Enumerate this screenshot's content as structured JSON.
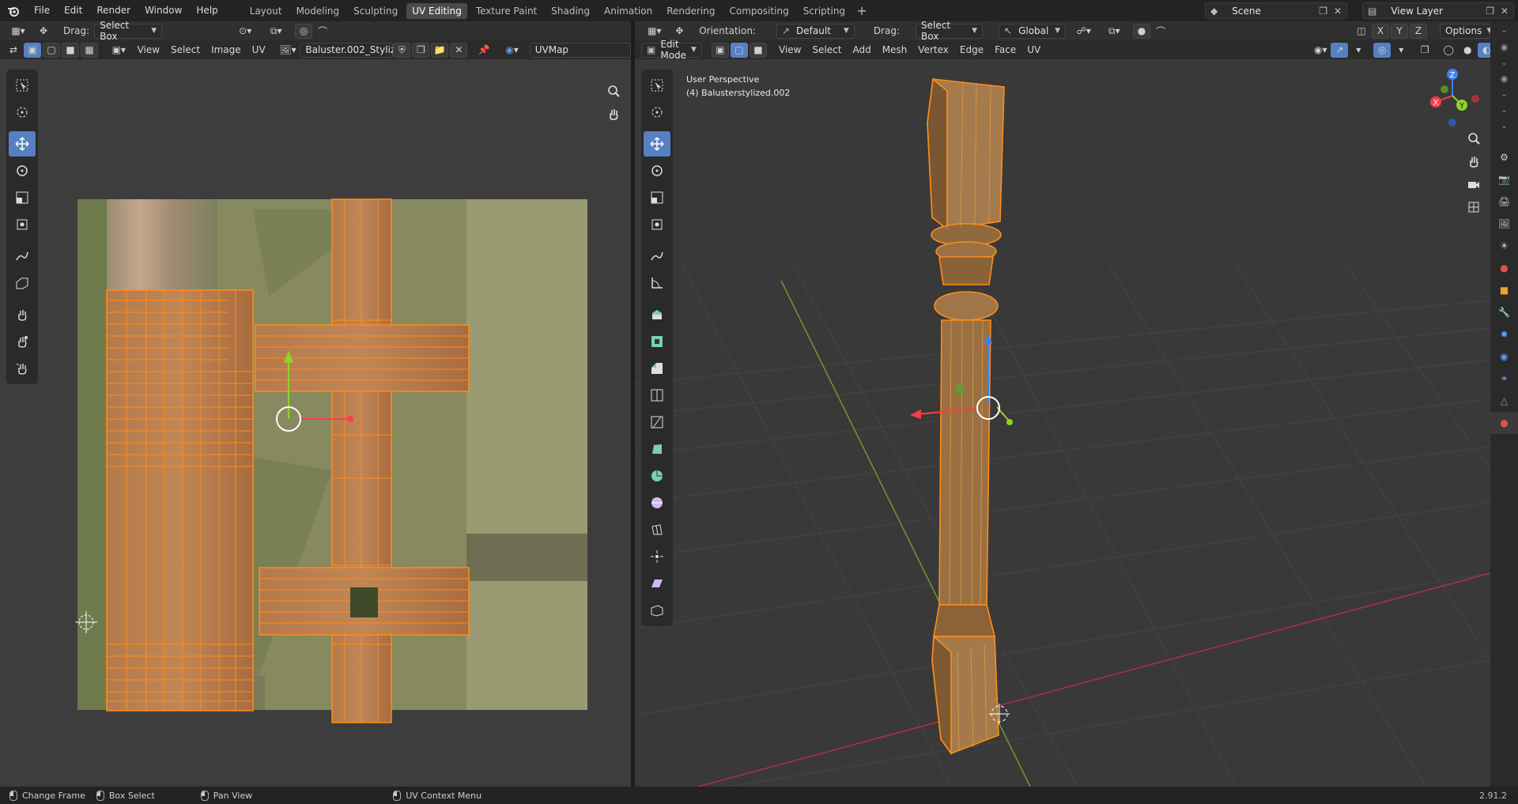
{
  "menu": {
    "items": [
      "File",
      "Edit",
      "Render",
      "Window",
      "Help"
    ]
  },
  "workspaces": {
    "tabs": [
      "Layout",
      "Modeling",
      "Sculpting",
      "UV Editing",
      "Texture Paint",
      "Shading",
      "Animation",
      "Rendering",
      "Compositing",
      "Scripting"
    ],
    "active": "UV Editing"
  },
  "scene": {
    "name": "Scene"
  },
  "view_layer": {
    "name": "View Layer"
  },
  "uv_editor": {
    "drag_label": "Drag:",
    "drag_value": "Select Box",
    "menus": [
      "View",
      "Select",
      "Image",
      "UV"
    ],
    "image_name": "Baluster.002_Styliz...",
    "uvmap_name": "UVMap"
  },
  "viewport": {
    "orientation_label": "Orientation:",
    "orientation_value": "Default",
    "drag_label": "Drag:",
    "drag_value": "Select Box",
    "transform_space": "Global",
    "options_label": "Options",
    "mode": "Edit Mode",
    "menus": [
      "View",
      "Select",
      "Add",
      "Mesh",
      "Vertex",
      "Edge",
      "Face",
      "UV"
    ],
    "overlay_line1": "User Perspective",
    "overlay_line2": "(4) Balusterstylized.002",
    "gizmo_axes": {
      "x": "X",
      "y": "Y",
      "z": "Z"
    },
    "mirror_axes": [
      "X",
      "Y",
      "Z"
    ]
  },
  "statusbar": {
    "items": [
      "Change Frame",
      "Box Select",
      "Pan View",
      "UV Context Menu"
    ],
    "version": "2.91.2"
  },
  "colors": {
    "accent": "#5680c2",
    "selection": "#ff8c1a",
    "texture_bg": "#8a8c62"
  }
}
